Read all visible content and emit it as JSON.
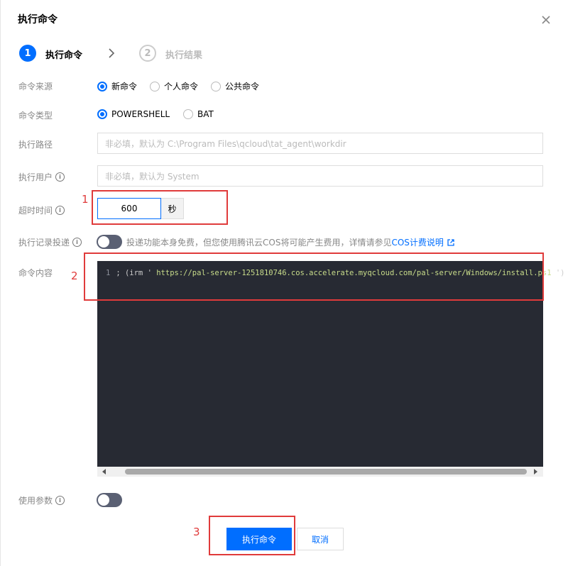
{
  "dialog": {
    "title": "执行命令",
    "close_icon": "close-icon"
  },
  "steps": [
    {
      "number": "1",
      "label": "执行命令",
      "state": "active"
    },
    {
      "number": "2",
      "label": "执行结果",
      "state": "inactive"
    }
  ],
  "form": {
    "source": {
      "label": "命令来源",
      "options": [
        "新命令",
        "个人命令",
        "公共命令"
      ],
      "selected": "新命令"
    },
    "type": {
      "label": "命令类型",
      "options": [
        "POWERSHELL",
        "BAT"
      ],
      "selected": "POWERSHELL"
    },
    "path": {
      "label": "执行路径",
      "placeholder": "非必填，默认为 C:\\Program Files\\qcloud\\tat_agent\\workdir"
    },
    "user": {
      "label": "执行用户",
      "placeholder": "非必填，默认为 System"
    },
    "timeout": {
      "label": "超时时间",
      "value": "600",
      "unit": "秒"
    },
    "log_delivery": {
      "label": "执行记录投递",
      "enabled": false,
      "hint": "投递功能本身免费，但您使用腾讯云COS将可能产生费用，详情请参见",
      "link": "COS计费说明"
    },
    "content": {
      "label": "命令内容",
      "line_number": "1",
      "code_prefix": "; (irm '",
      "code_string": " https://pal-server-1251810746.cos.accelerate.myqcloud.com/pal-server/Windows/install.ps1 ",
      "code_suffix": "')"
    },
    "params": {
      "label": "使用参数",
      "enabled": false
    }
  },
  "buttons": {
    "execute": "执行命令",
    "cancel": "取消"
  },
  "annotations": [
    "1",
    "2",
    "3"
  ],
  "colors": {
    "primary": "#006eff",
    "annotation": "#e03b3b",
    "editor_bg": "#272a33"
  }
}
